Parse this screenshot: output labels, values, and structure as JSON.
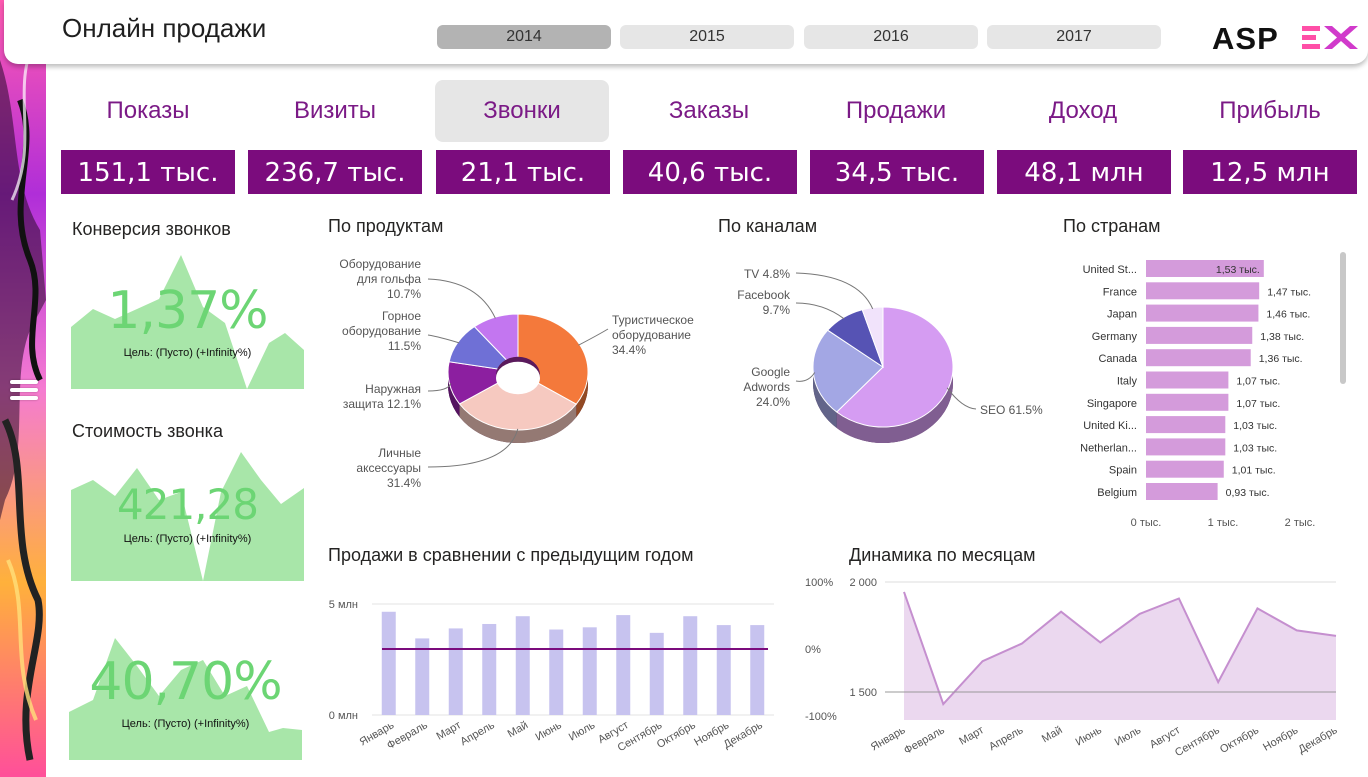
{
  "header": {
    "title": "Онлайн продажи",
    "years": [
      {
        "label": "2014",
        "active": true
      },
      {
        "label": "2015",
        "active": false
      },
      {
        "label": "2016",
        "active": false
      },
      {
        "label": "2017",
        "active": false
      }
    ],
    "logo_text": "ASPEX"
  },
  "kpis": [
    {
      "label": "Показы",
      "value": "151,1 тыс.",
      "active": false
    },
    {
      "label": "Визиты",
      "value": "236,7 тыс.",
      "active": false
    },
    {
      "label": "Звонки",
      "value": "21,1 тыс.",
      "active": true
    },
    {
      "label": "Заказы",
      "value": "40,6 тыс.",
      "active": false
    },
    {
      "label": "Продажи",
      "value": "34,5 тыс.",
      "active": false
    },
    {
      "label": "Доход",
      "value": "48,1 млн",
      "active": false
    },
    {
      "label": "Прибыль",
      "value": "12,5 млн",
      "active": false
    }
  ],
  "cards": {
    "conversion": {
      "title": "Конверсия звонков",
      "value": "1,37%",
      "goal": "Цель: (Пусто) (+Infinity%)"
    },
    "cost": {
      "title": "Стоимость звонка",
      "value": "421,28",
      "goal": "Цель: (Пусто) (+Infinity%)"
    },
    "third": {
      "value": "40,70%",
      "goal": "Цель: (Пусто) (+Infinity%)"
    }
  },
  "sections": {
    "products": "По продуктам",
    "channels": "По каналам",
    "countries": "По странам",
    "yoy": "Продажи в сравнении с предыдущим годом",
    "monthly": "Динамика по месяцам"
  },
  "colors": {
    "accent": "#7b0c7d",
    "kpi_text": "#7b1a86",
    "green": "#6cd574",
    "green_fill": "#a8e6a9",
    "bar_lilac": "#c7c3ef",
    "country_bar": "#d49bdb",
    "area_fill": "#e8d1ec",
    "area_line": "#c58fcf"
  },
  "chart_data": [
    {
      "type": "pie",
      "title": "По продуктам",
      "slices": [
        {
          "label": "Туристическое оборудование",
          "value": 34.4,
          "pct_text": "34.4%",
          "color": "#f4793b"
        },
        {
          "label": "Личные аксессуары",
          "value": 31.4,
          "pct_text": "31.4%",
          "color": "#f6c9c0"
        },
        {
          "label": "Наружная защита",
          "value": 12.1,
          "pct_text": "12.1%",
          "color": "#8c1fa0"
        },
        {
          "label": "Горное оборудование",
          "value": 11.5,
          "pct_text": "11.5%",
          "color": "#6f70d6"
        },
        {
          "label": "Оборудование для гольфа",
          "value": 10.7,
          "pct_text": "10.7%",
          "color": "#c376f0"
        }
      ]
    },
    {
      "type": "pie",
      "title": "По каналам",
      "slices": [
        {
          "label": "SEO",
          "value": 61.5,
          "pct_text": "61.5%",
          "color": "#d59cf2"
        },
        {
          "label": "Google Adwords",
          "value": 24.0,
          "pct_text": "24.0%",
          "color": "#a3a7e4"
        },
        {
          "label": "Facebook",
          "value": 9.7,
          "pct_text": "9.7%",
          "color": "#5653b4"
        },
        {
          "label": "TV",
          "value": 4.8,
          "pct_text": "4.8%",
          "color": "#f1e3fb"
        }
      ]
    },
    {
      "type": "bar",
      "title": "По странам",
      "categories": [
        "United St...",
        "France",
        "Japan",
        "Germany",
        "Canada",
        "Italy",
        "Singapore",
        "United Ki...",
        "Netherlan...",
        "Spain",
        "Belgium"
      ],
      "values": [
        1.53,
        1.47,
        1.46,
        1.38,
        1.36,
        1.07,
        1.07,
        1.03,
        1.03,
        1.01,
        0.93
      ],
      "value_labels": [
        "1,53 тыс.",
        "1,47 тыс.",
        "1,46 тыс.",
        "1,38 тыс.",
        "1,36 тыс.",
        "1,07 тыс.",
        "1,07 тыс.",
        "1,03 тыс.",
        "1,03 тыс.",
        "1,01 тыс.",
        "0,93 тыс."
      ],
      "xticks": [
        "0 тыс.",
        "1 тыс.",
        "2 тыс."
      ],
      "xlim": [
        0,
        2
      ]
    },
    {
      "type": "bar",
      "title": "Продажи в сравнении с предыдущим годом",
      "categories": [
        "Январь",
        "Февраль",
        "Март",
        "Апрель",
        "Май",
        "Июнь",
        "Июль",
        "Август",
        "Сентябрь",
        "Октябрь",
        "Ноябрь",
        "Декабрь"
      ],
      "values": [
        4.65,
        3.45,
        3.9,
        4.1,
        4.45,
        3.85,
        3.95,
        4.5,
        3.7,
        4.45,
        4.05,
        4.05
      ],
      "ylim": [
        0,
        5
      ],
      "yticks_left": [
        "5 млн",
        "0 млн"
      ],
      "yticks_right": [
        "100%",
        "0%",
        "-100%"
      ],
      "line": {
        "value_pct": 0
      }
    },
    {
      "type": "area",
      "title": "Динамика по месяцам",
      "categories": [
        "Январь",
        "Февраль",
        "Март",
        "Апрель",
        "Май",
        "Июнь",
        "Июль",
        "Август",
        "Сентябрь",
        "Октябрь",
        "Ноябрь",
        "Декабрь"
      ],
      "values": [
        1955,
        1445,
        1640,
        1720,
        1865,
        1725,
        1855,
        1925,
        1545,
        1880,
        1780,
        1755
      ],
      "ylim": [
        1400,
        2000
      ],
      "yticks": [
        "2 000",
        "1 500"
      ]
    }
  ]
}
